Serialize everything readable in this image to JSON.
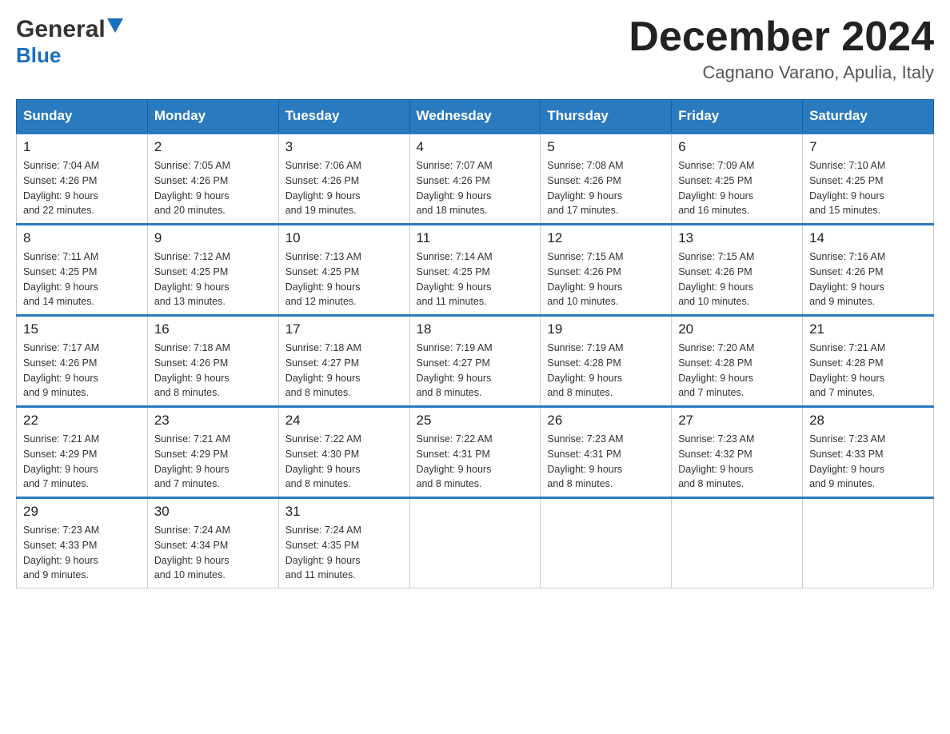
{
  "logo": {
    "text_general": "General",
    "text_blue": "Blue",
    "arrow": "▶"
  },
  "title": {
    "month_year": "December 2024",
    "location": "Cagnano Varano, Apulia, Italy"
  },
  "weekdays": [
    "Sunday",
    "Monday",
    "Tuesday",
    "Wednesday",
    "Thursday",
    "Friday",
    "Saturday"
  ],
  "weeks": [
    [
      {
        "day": "1",
        "sunrise": "7:04 AM",
        "sunset": "4:26 PM",
        "daylight": "9 hours and 22 minutes."
      },
      {
        "day": "2",
        "sunrise": "7:05 AM",
        "sunset": "4:26 PM",
        "daylight": "9 hours and 20 minutes."
      },
      {
        "day": "3",
        "sunrise": "7:06 AM",
        "sunset": "4:26 PM",
        "daylight": "9 hours and 19 minutes."
      },
      {
        "day": "4",
        "sunrise": "7:07 AM",
        "sunset": "4:26 PM",
        "daylight": "9 hours and 18 minutes."
      },
      {
        "day": "5",
        "sunrise": "7:08 AM",
        "sunset": "4:26 PM",
        "daylight": "9 hours and 17 minutes."
      },
      {
        "day": "6",
        "sunrise": "7:09 AM",
        "sunset": "4:25 PM",
        "daylight": "9 hours and 16 minutes."
      },
      {
        "day": "7",
        "sunrise": "7:10 AM",
        "sunset": "4:25 PM",
        "daylight": "9 hours and 15 minutes."
      }
    ],
    [
      {
        "day": "8",
        "sunrise": "7:11 AM",
        "sunset": "4:25 PM",
        "daylight": "9 hours and 14 minutes."
      },
      {
        "day": "9",
        "sunrise": "7:12 AM",
        "sunset": "4:25 PM",
        "daylight": "9 hours and 13 minutes."
      },
      {
        "day": "10",
        "sunrise": "7:13 AM",
        "sunset": "4:25 PM",
        "daylight": "9 hours and 12 minutes."
      },
      {
        "day": "11",
        "sunrise": "7:14 AM",
        "sunset": "4:25 PM",
        "daylight": "9 hours and 11 minutes."
      },
      {
        "day": "12",
        "sunrise": "7:15 AM",
        "sunset": "4:26 PM",
        "daylight": "9 hours and 10 minutes."
      },
      {
        "day": "13",
        "sunrise": "7:15 AM",
        "sunset": "4:26 PM",
        "daylight": "9 hours and 10 minutes."
      },
      {
        "day": "14",
        "sunrise": "7:16 AM",
        "sunset": "4:26 PM",
        "daylight": "9 hours and 9 minutes."
      }
    ],
    [
      {
        "day": "15",
        "sunrise": "7:17 AM",
        "sunset": "4:26 PM",
        "daylight": "9 hours and 9 minutes."
      },
      {
        "day": "16",
        "sunrise": "7:18 AM",
        "sunset": "4:26 PM",
        "daylight": "9 hours and 8 minutes."
      },
      {
        "day": "17",
        "sunrise": "7:18 AM",
        "sunset": "4:27 PM",
        "daylight": "9 hours and 8 minutes."
      },
      {
        "day": "18",
        "sunrise": "7:19 AM",
        "sunset": "4:27 PM",
        "daylight": "9 hours and 8 minutes."
      },
      {
        "day": "19",
        "sunrise": "7:19 AM",
        "sunset": "4:28 PM",
        "daylight": "9 hours and 8 minutes."
      },
      {
        "day": "20",
        "sunrise": "7:20 AM",
        "sunset": "4:28 PM",
        "daylight": "9 hours and 7 minutes."
      },
      {
        "day": "21",
        "sunrise": "7:21 AM",
        "sunset": "4:28 PM",
        "daylight": "9 hours and 7 minutes."
      }
    ],
    [
      {
        "day": "22",
        "sunrise": "7:21 AM",
        "sunset": "4:29 PM",
        "daylight": "9 hours and 7 minutes."
      },
      {
        "day": "23",
        "sunrise": "7:21 AM",
        "sunset": "4:29 PM",
        "daylight": "9 hours and 7 minutes."
      },
      {
        "day": "24",
        "sunrise": "7:22 AM",
        "sunset": "4:30 PM",
        "daylight": "9 hours and 8 minutes."
      },
      {
        "day": "25",
        "sunrise": "7:22 AM",
        "sunset": "4:31 PM",
        "daylight": "9 hours and 8 minutes."
      },
      {
        "day": "26",
        "sunrise": "7:23 AM",
        "sunset": "4:31 PM",
        "daylight": "9 hours and 8 minutes."
      },
      {
        "day": "27",
        "sunrise": "7:23 AM",
        "sunset": "4:32 PM",
        "daylight": "9 hours and 8 minutes."
      },
      {
        "day": "28",
        "sunrise": "7:23 AM",
        "sunset": "4:33 PM",
        "daylight": "9 hours and 9 minutes."
      }
    ],
    [
      {
        "day": "29",
        "sunrise": "7:23 AM",
        "sunset": "4:33 PM",
        "daylight": "9 hours and 9 minutes."
      },
      {
        "day": "30",
        "sunrise": "7:24 AM",
        "sunset": "4:34 PM",
        "daylight": "9 hours and 10 minutes."
      },
      {
        "day": "31",
        "sunrise": "7:24 AM",
        "sunset": "4:35 PM",
        "daylight": "9 hours and 11 minutes."
      },
      null,
      null,
      null,
      null
    ]
  ],
  "labels": {
    "sunrise": "Sunrise:",
    "sunset": "Sunset:",
    "daylight": "Daylight:"
  }
}
